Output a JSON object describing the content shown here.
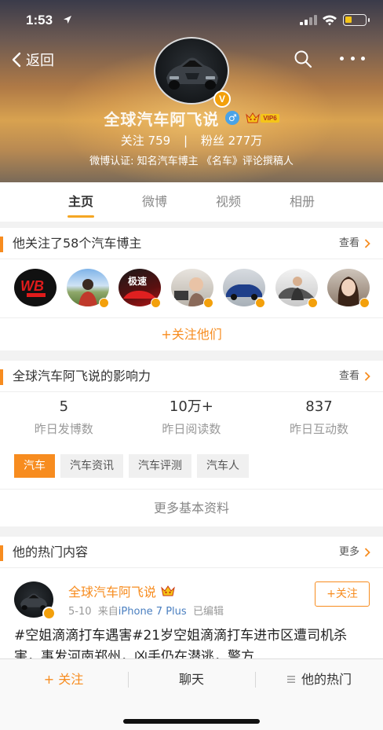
{
  "status_bar": {
    "time": "1:53",
    "battery_level": 0.35
  },
  "header": {
    "back_label": "返回",
    "profile_name": "全球汽车阿飞说",
    "gender_symbol": "♂",
    "vip_label": "VIP6",
    "following_label": "关注",
    "following_count": "759",
    "separator": "|",
    "followers_label": "粉丝",
    "followers_count": "277万",
    "verification": "微博认证: 知名汽车博主 《名车》评论撰稿人",
    "verified_badge": "V"
  },
  "tabs": [
    {
      "label": "主页"
    },
    {
      "label": "微博"
    },
    {
      "label": "视频"
    },
    {
      "label": "相册"
    }
  ],
  "follow_card": {
    "title": "他关注了58个汽车博主",
    "link": "查看",
    "follow_all": "+关注他们",
    "avatars": [
      {
        "name": "wb-racing",
        "text": "WB"
      },
      {
        "name": "landscape-person"
      },
      {
        "name": "red-car-poster",
        "text": "极速"
      },
      {
        "name": "child-in-car"
      },
      {
        "name": "blue-sedan"
      },
      {
        "name": "man-with-car"
      },
      {
        "name": "woman-portrait"
      }
    ]
  },
  "influence_card": {
    "title": "全球汽车阿飞说的影响力",
    "link": "查看",
    "stats": [
      {
        "value": "5",
        "label": "昨日发博数"
      },
      {
        "value": "10万+",
        "label": "昨日阅读数"
      },
      {
        "value": "837",
        "label": "昨日互动数"
      }
    ],
    "tags": [
      "汽车",
      "汽车资讯",
      "汽车评测",
      "汽车人"
    ],
    "more_info": "更多基本资料"
  },
  "hot_card": {
    "title": "他的热门内容",
    "link": "更多",
    "post": {
      "author": "全球汽车阿飞说",
      "date": "5-10",
      "from_label": "来自",
      "source": "iPhone 7 Plus",
      "edited": "已编辑",
      "follow_button": "+关注",
      "text": "#空姐滴滴打车遇害#21岁空姐滴滴打车进市区遭司机杀害，事发河南郑州，凶手仍在潜逃，警方"
    }
  },
  "bottom_bar": {
    "follow": "+ 关注",
    "chat": "聊天",
    "hot": "他的热门"
  },
  "colors": {
    "accent": "#f78c1f",
    "verified": "#f3a00b",
    "link_blue": "#4a7fc0"
  }
}
